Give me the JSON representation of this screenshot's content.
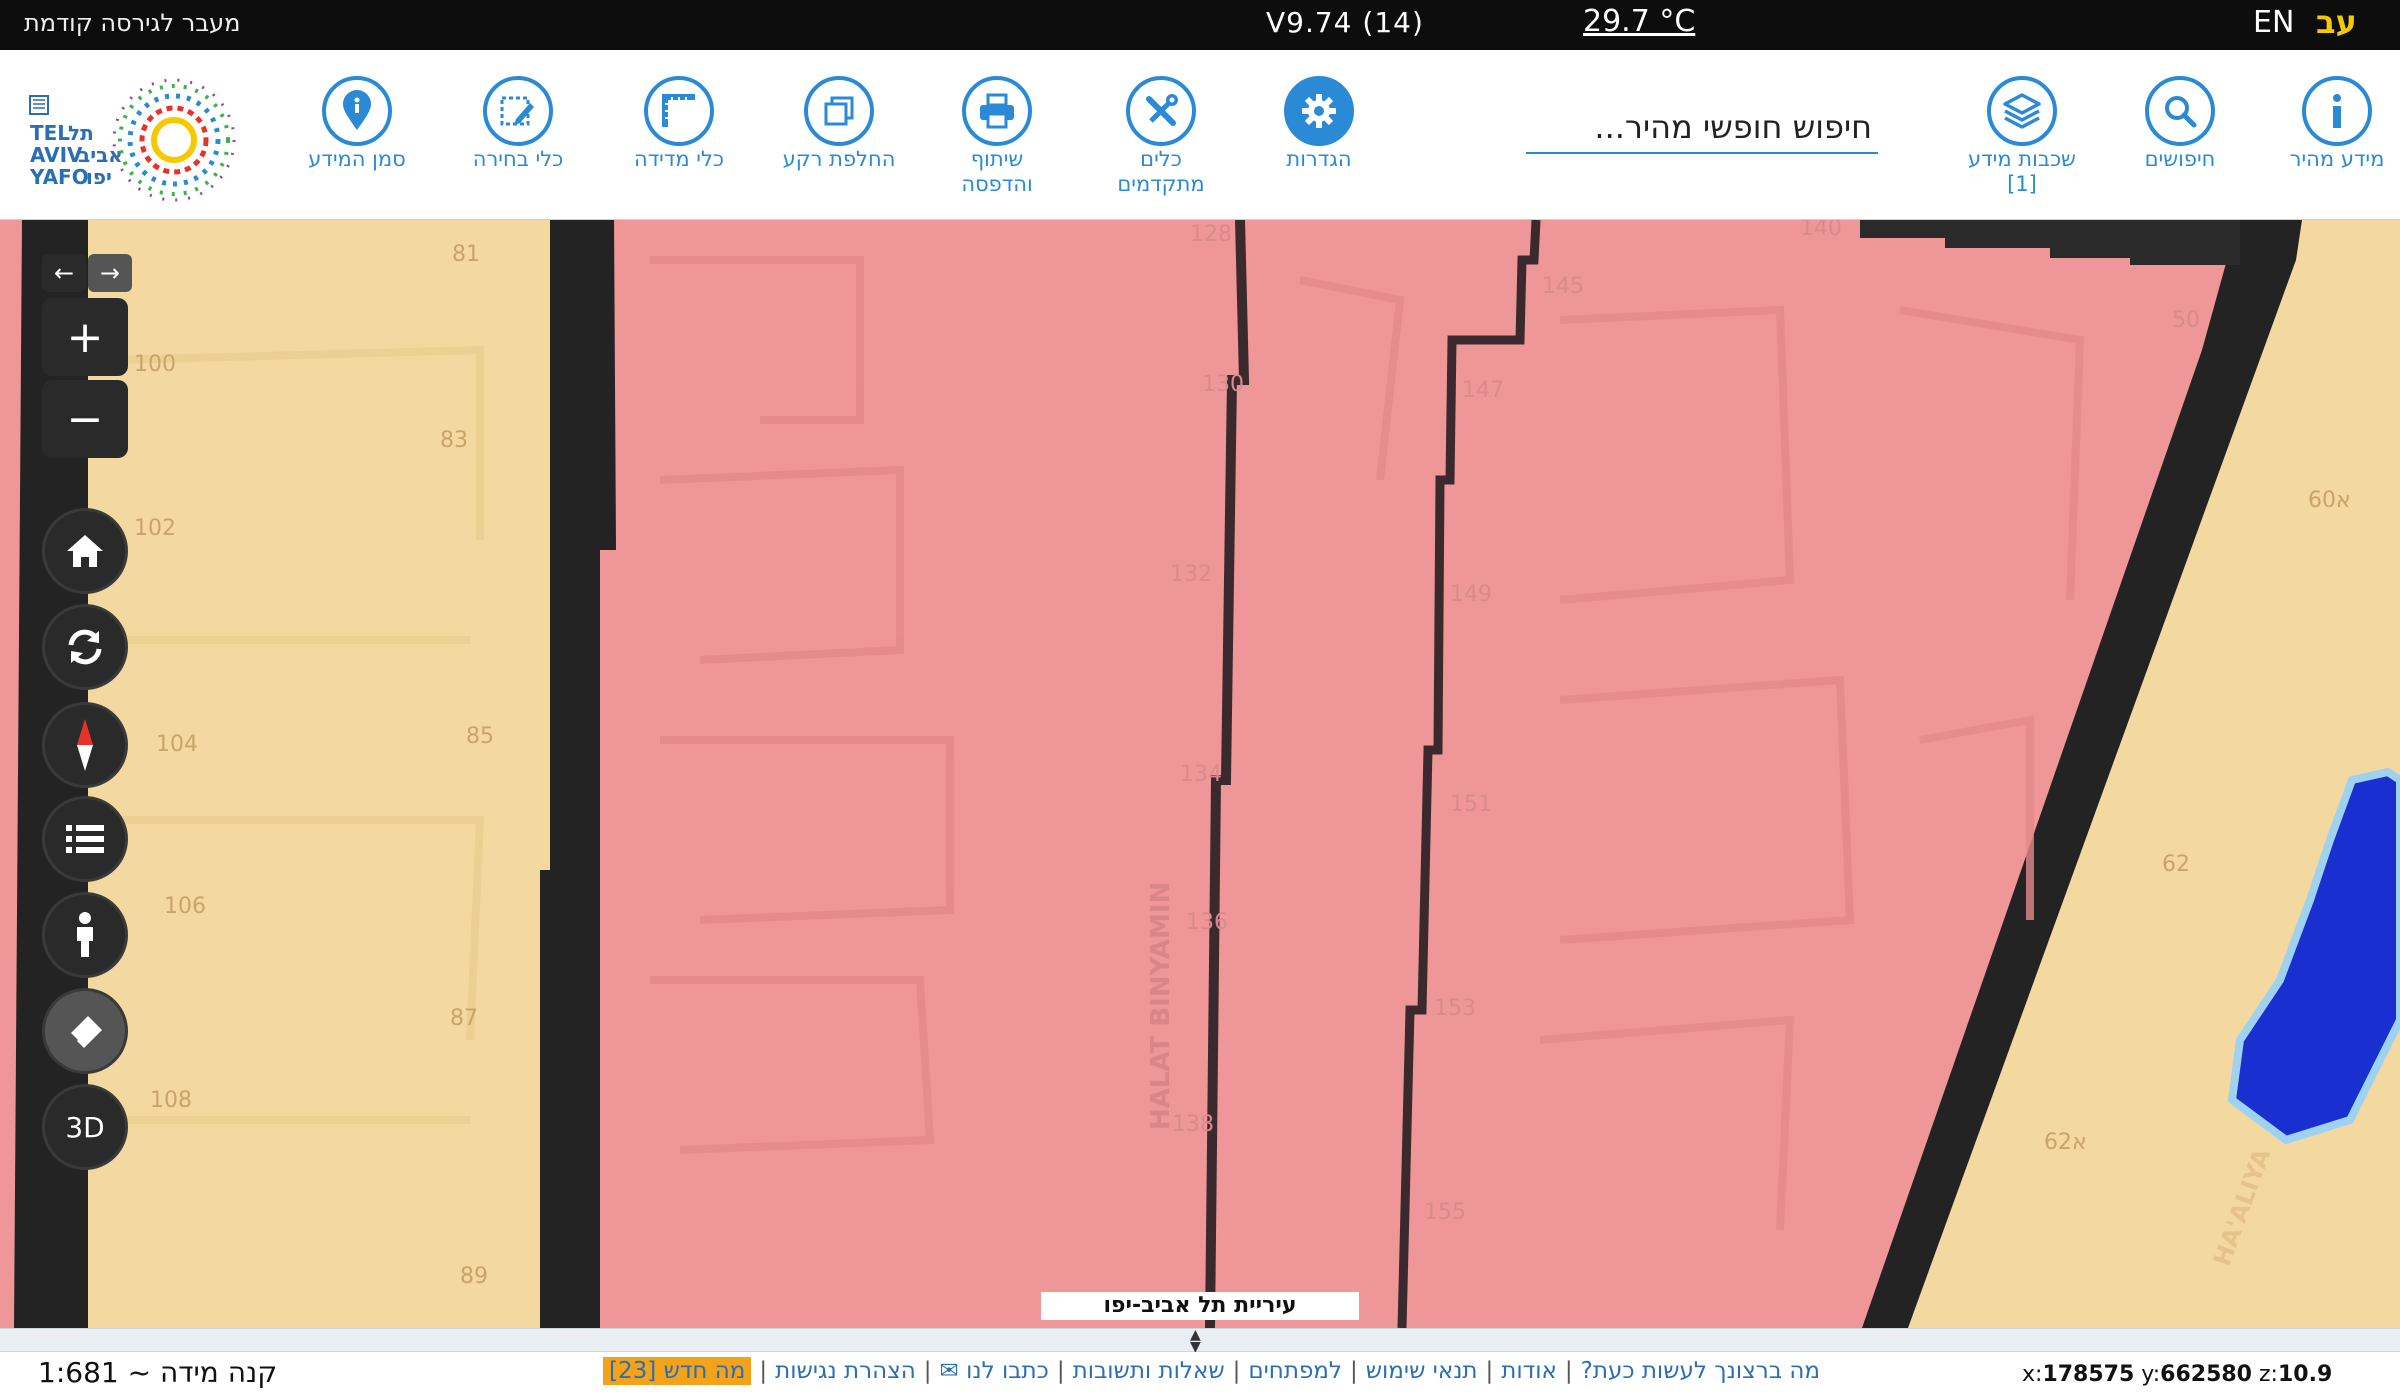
{
  "topbar": {
    "previous_version": "מעבר לגירסה קודמת",
    "version": "V9.74 (14)",
    "temperature": "29.7 °C",
    "lang_en": "EN",
    "lang_he": "עב"
  },
  "toolbar": {
    "search_placeholder": "חיפוש חופשי מהיר...",
    "tools": [
      {
        "id": "quick-info",
        "label": "מידע מהיר",
        "label2": "",
        "icon": "info-icon"
      },
      {
        "id": "searches",
        "label": "חיפושים",
        "label2": "",
        "icon": "search-icon"
      },
      {
        "id": "layers",
        "label": "שכבות מידע",
        "label2": "[1]",
        "icon": "layers-icon"
      },
      {
        "id": "settings",
        "label": "הגדרות",
        "label2": "",
        "icon": "gear-icon"
      },
      {
        "id": "advanced-tools",
        "label": "כלים",
        "label2": "מתקדמים",
        "icon": "tools-icon"
      },
      {
        "id": "share-print",
        "label": "שיתוף",
        "label2": "והדפסה",
        "icon": "printer-icon"
      },
      {
        "id": "basemap",
        "label": "החלפת רקע",
        "label2": "",
        "icon": "basemap-icon"
      },
      {
        "id": "measure",
        "label": "כלי מדידה",
        "label2": "",
        "icon": "ruler-icon"
      },
      {
        "id": "select",
        "label": "כלי בחירה",
        "label2": "",
        "icon": "select-icon"
      },
      {
        "id": "marker",
        "label": "סמן המידע",
        "label2": "",
        "icon": "marker-icon"
      }
    ],
    "logo_text": "TEL AVIV YAFO תל אביב יפו"
  },
  "map": {
    "parcel_numbers": [
      "81",
      "100",
      "83",
      "102",
      "104",
      "85",
      "106",
      "87",
      "108",
      "89",
      "128",
      "130",
      "132",
      "134",
      "136",
      "138",
      "140",
      "145",
      "147",
      "149",
      "151",
      "153",
      "155",
      "50",
      "60א",
      "62",
      "62א"
    ],
    "street_labels": [
      "HALAT BINYAMIN",
      "HA'ALIYA"
    ],
    "credit": "עיריית תל אביב-יפו",
    "zone_colors": {
      "residential": "#f3d9a0",
      "commercial": "#ef9699",
      "water": "#1a2fd0",
      "road": "#232323"
    }
  },
  "controls": {
    "three_d_label": "3D"
  },
  "footer": {
    "scale_label": "קנה מידה ~ 1:681",
    "links": [
      "מה ברצונך לעשות כעת?",
      "אודות",
      "תנאי שימוש",
      "למפתחים",
      "שאלות ותשובות",
      "כתבו לנו ✉",
      "הצהרת נגישות"
    ],
    "whats_new": "מה חדש [23]",
    "coord_x_label": "x:",
    "coord_x": "178575",
    "coord_y_label": "y:",
    "coord_y": "662580",
    "coord_z_label": "z:",
    "coord_z": "10.9"
  }
}
